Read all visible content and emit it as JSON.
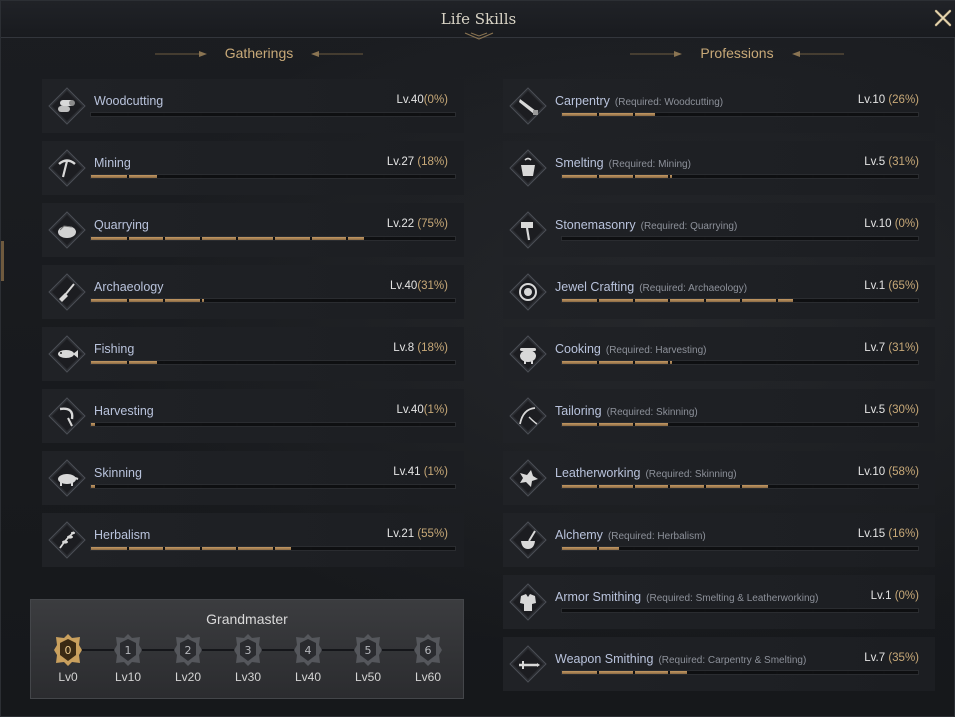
{
  "window": {
    "title": "Life Skills",
    "close_icon": "close-x-icon"
  },
  "gatherings": {
    "heading": "Gatherings",
    "skills": [
      {
        "name": "Woodcutting",
        "icon": "logs-icon",
        "level": "Lv.40",
        "percent": "(0%)",
        "progress": 0.0
      },
      {
        "name": "Mining",
        "icon": "pickaxe-icon",
        "level": "Lv.27",
        "percent": " (18%)",
        "progress": 0.18
      },
      {
        "name": "Quarrying",
        "icon": "stone-icon",
        "level": "Lv.22",
        "percent": " (75%)",
        "progress": 0.75
      },
      {
        "name": "Archaeology",
        "icon": "shovel-icon",
        "level": "Lv.40",
        "percent": "(31%)",
        "progress": 0.31
      },
      {
        "name": "Fishing",
        "icon": "fish-icon",
        "level": "Lv.8",
        "percent": " (18%)",
        "progress": 0.18
      },
      {
        "name": "Harvesting",
        "icon": "sickle-icon",
        "level": "Lv.40",
        "percent": "(1%)",
        "progress": 0.01
      },
      {
        "name": "Skinning",
        "icon": "boar-icon",
        "level": "Lv.41",
        "percent": " (1%)",
        "progress": 0.01
      },
      {
        "name": "Herbalism",
        "icon": "herb-icon",
        "level": "Lv.21",
        "percent": " (55%)",
        "progress": 0.55
      }
    ]
  },
  "professions": {
    "heading": "Professions",
    "skills": [
      {
        "name": "Carpentry",
        "required": "(Required: Woodcutting)",
        "icon": "saw-icon",
        "level": "Lv.10",
        "percent": " (26%)",
        "progress": 0.26
      },
      {
        "name": "Smelting",
        "required": "(Required: Mining)",
        "icon": "crucible-icon",
        "level": "Lv.5",
        "percent": " (31%)",
        "progress": 0.31
      },
      {
        "name": "Stonemasonry",
        "required": "(Required: Quarrying)",
        "icon": "hammer-icon",
        "level": "Lv.10",
        "percent": " (0%)",
        "progress": 0.0
      },
      {
        "name": "Jewel Crafting",
        "required": "(Required: Archaeology)",
        "icon": "gem-icon",
        "level": "Lv.1",
        "percent": " (65%)",
        "progress": 0.65
      },
      {
        "name": "Cooking",
        "required": "(Required: Harvesting)",
        "icon": "pot-icon",
        "level": "Lv.7",
        "percent": " (31%)",
        "progress": 0.31
      },
      {
        "name": "Tailoring",
        "required": "(Required: Skinning)",
        "icon": "needle-icon",
        "level": "Lv.5",
        "percent": " (30%)",
        "progress": 0.3
      },
      {
        "name": "Leatherworking",
        "required": "(Required: Skinning)",
        "icon": "leather-icon",
        "level": "Lv.10",
        "percent": " (58%)",
        "progress": 0.58
      },
      {
        "name": "Alchemy",
        "required": "(Required: Herbalism)",
        "icon": "mortar-icon",
        "level": "Lv.15",
        "percent": " (16%)",
        "progress": 0.16
      },
      {
        "name": "Armor Smithing",
        "required": "(Required: Smelting & Leatherworking)",
        "icon": "armor-icon",
        "level": "Lv.1",
        "percent": " (0%)",
        "progress": 0.0
      },
      {
        "name": "Weapon Smithing",
        "required": "(Required: Carpentry & Smelting)",
        "icon": "sword-icon",
        "level": "Lv.7",
        "percent": " (35%)",
        "progress": 0.35
      }
    ]
  },
  "grandmaster": {
    "title": "Grandmaster",
    "nodes": [
      {
        "num": "0",
        "label": "Lv0",
        "active": true
      },
      {
        "num": "1",
        "label": "Lv10",
        "active": false
      },
      {
        "num": "2",
        "label": "Lv20",
        "active": false
      },
      {
        "num": "3",
        "label": "Lv30",
        "active": false
      },
      {
        "num": "4",
        "label": "Lv40",
        "active": false
      },
      {
        "num": "5",
        "label": "Lv50",
        "active": false
      },
      {
        "num": "6",
        "label": "Lv60",
        "active": false
      }
    ]
  },
  "colors": {
    "accent": "#c8a978",
    "bar_fill": "#b08656",
    "name": "#b9c3dc"
  }
}
